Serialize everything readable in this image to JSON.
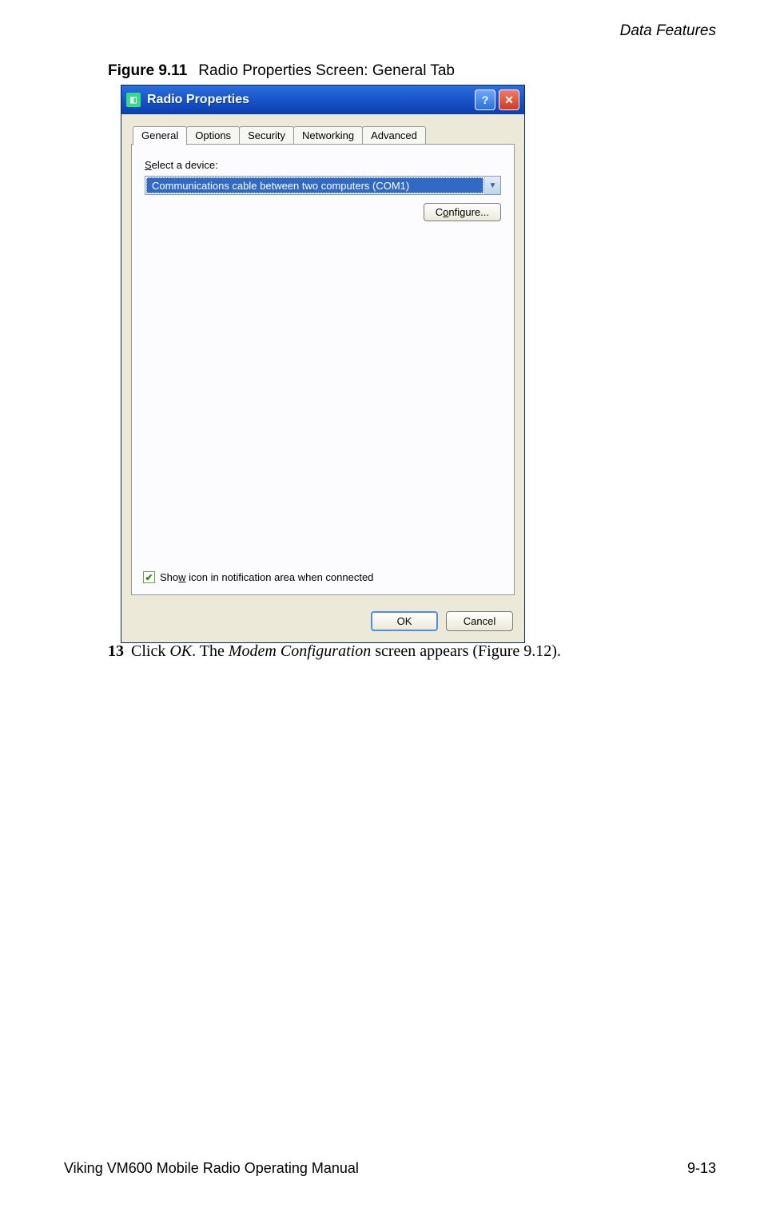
{
  "page": {
    "header_section": "Data Features",
    "footer_manual": "Viking VM600 Mobile Radio Operating Manual",
    "footer_page": "9-13"
  },
  "figure": {
    "number": "Figure 9.11",
    "title": "Radio Properties Screen: General Tab"
  },
  "dialog": {
    "title": "Radio Properties",
    "tabs": [
      "General",
      "Options",
      "Security",
      "Networking",
      "Advanced"
    ],
    "active_tab": "General",
    "select_label_pre": "S",
    "select_label_post": "elect a device:",
    "device_selected": "Communications cable between two computers (COM1)",
    "configure_label_pre": "C",
    "configure_label_mid": "o",
    "configure_label_post": "nfigure...",
    "show_icon_label_pre": "Sho",
    "show_icon_label_u": "w",
    "show_icon_label_post": " icon in notification area when connected",
    "show_icon_checked": true,
    "ok_label": "OK",
    "cancel_label": "Cancel"
  },
  "step": {
    "number": "13",
    "pre": " Click ",
    "italic1": "OK",
    "mid": ". The ",
    "italic2": "Modem Configuration",
    "post": " screen appears (Figure 9.12)."
  }
}
